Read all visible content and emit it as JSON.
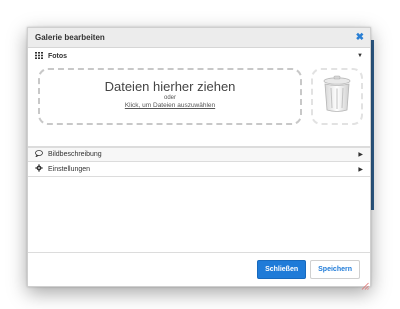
{
  "dialog": {
    "title": "Galerie bearbeiten",
    "close_icon": "close-icon"
  },
  "photos": {
    "label": "Fotos",
    "icon": "grid-icon",
    "dropzone": {
      "title": "Dateien hierher ziehen",
      "or": "oder",
      "link": "Klick, um Dateien auszuwählen"
    },
    "trash_icon": "trash-can-icon"
  },
  "sections": [
    {
      "label": "Bildbeschreibung",
      "icon": "speech-bubble-icon"
    },
    {
      "label": "Einstellungen",
      "icon": "gear-icon"
    }
  ],
  "footer": {
    "close_label": "Schließen",
    "save_label": "Speichern"
  },
  "colors": {
    "accent": "#1f7bd8",
    "titlebar": "#ececec"
  }
}
